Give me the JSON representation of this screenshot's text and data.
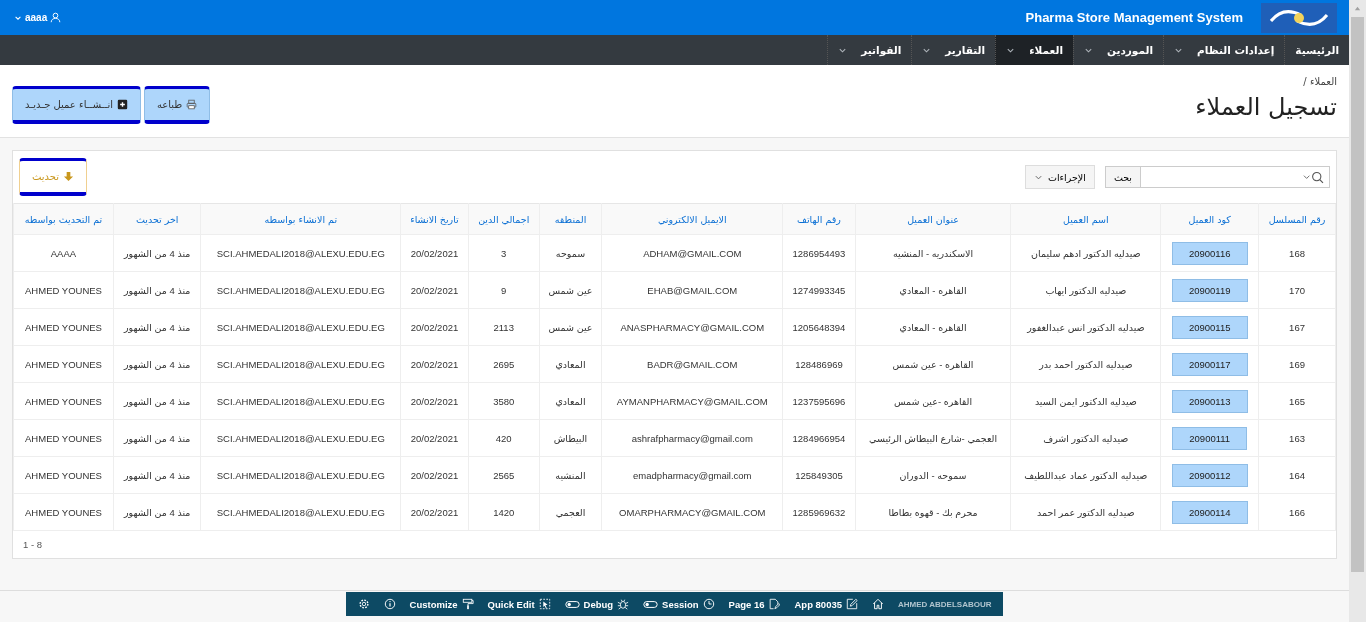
{
  "header": {
    "title": "Pharma Store Management System",
    "user": "aaaa"
  },
  "nav": [
    {
      "label": "الرئيسية",
      "selected": false,
      "dropdown": false
    },
    {
      "label": "إعدادات النظام",
      "selected": false,
      "dropdown": true
    },
    {
      "label": "الموردين",
      "selected": false,
      "dropdown": true
    },
    {
      "label": "العملاء",
      "selected": true,
      "dropdown": true
    },
    {
      "label": "التقارير",
      "selected": false,
      "dropdown": true
    },
    {
      "label": "الفواتير",
      "selected": false,
      "dropdown": true
    }
  ],
  "breadcrumb": "العملاء /",
  "page_title": "تسجيل العملاء",
  "buttons": [
    {
      "label": "طباعه",
      "kind": "print"
    },
    {
      "label": "انــشــاء عميل جـديـد",
      "kind": "create"
    }
  ],
  "toolbar": {
    "search_button": "بحث",
    "actions": "الإجراءات",
    "refresh": "تحديث"
  },
  "table": {
    "columns": [
      "رقم المسلسل",
      "كود العميل",
      "اسم العميل",
      "عنوان العميل",
      "رقم الهاتف",
      "الايميل الالكتروني",
      "المنطقه",
      "اجمالي الدين",
      "تاريخ الانشاء",
      "تم الانشاء بواسطه",
      "اخر تحديث",
      "تم التحديث بواسطه"
    ],
    "rows": [
      [
        "168",
        "20900116",
        "صيدليه الدكتور ادهم سليمان",
        "الاسكندريه - المنشيه",
        "1286954493",
        "ADHAM@GMAIL.COM",
        "سموحه",
        "3",
        "20/02/2021",
        "SCI.AHMEDALI2018@ALEXU.EDU.EG",
        "منذ 4 من الشهور",
        "AAAA"
      ],
      [
        "170",
        "20900119",
        "صيدليه الدكتور ايهاب",
        "القاهره - المعادي",
        "1274993345",
        "EHAB@GMAIL.COM",
        "عين شمس",
        "9",
        "20/02/2021",
        "SCI.AHMEDALI2018@ALEXU.EDU.EG",
        "منذ 4 من الشهور",
        "AHMED YOUNES"
      ],
      [
        "167",
        "20900115",
        "صيدليه الدكتور انس عبدالغفور",
        "القاهره - المعادي",
        "1205648394",
        "ANASPHARMACY@GMAIL.COM",
        "عين شمس",
        "2113",
        "20/02/2021",
        "SCI.AHMEDALI2018@ALEXU.EDU.EG",
        "منذ 4 من الشهور",
        "AHMED YOUNES"
      ],
      [
        "169",
        "20900117",
        "صيدليه الدكتور احمد بدر",
        "القاهره - عين شمس",
        "128486969",
        "BADR@GMAIL.COM",
        "المعادي",
        "2695",
        "20/02/2021",
        "SCI.AHMEDALI2018@ALEXU.EDU.EG",
        "منذ 4 من الشهور",
        "AHMED YOUNES"
      ],
      [
        "165",
        "20900113",
        "صيدليه الدكتور ايمن السيد",
        "القاهره -عين شمس",
        "1237595696",
        "AYMANPHARMACY@GMAIL.COM",
        "المعادي",
        "3580",
        "20/02/2021",
        "SCI.AHMEDALI2018@ALEXU.EDU.EG",
        "منذ 4 من الشهور",
        "AHMED YOUNES"
      ],
      [
        "163",
        "20900111",
        "صيدليه الدكتور اشرف",
        "العجمي -شارع البيطاش الرئيسي",
        "1284966954",
        "ashrafpharmacy@gmail.com",
        "البيطاش",
        "420",
        "20/02/2021",
        "SCI.AHMEDALI2018@ALEXU.EDU.EG",
        "منذ 4 من الشهور",
        "AHMED YOUNES"
      ],
      [
        "164",
        "20900112",
        "صيدليه الدكتور عماد عبداللطيف",
        "سموحه - الدوران",
        "125849305",
        "emadpharmacy@gmail.com",
        "المنشيه",
        "2565",
        "20/02/2021",
        "SCI.AHMEDALI2018@ALEXU.EDU.EG",
        "منذ 4 من الشهور",
        "AHMED YOUNES"
      ],
      [
        "166",
        "20900114",
        "صيدليه الدكتور عمر احمد",
        "محرم بك - قهوه بطاطا",
        "1285969632",
        "OMARPHARMACY@GMAIL.COM",
        "العجمي",
        "1420",
        "20/02/2021",
        "SCI.AHMEDALI2018@ALEXU.EDU.EG",
        "منذ 4 من الشهور",
        "AHMED YOUNES"
      ]
    ],
    "pagination": "1 - 8"
  },
  "dev_toolbar": [
    {
      "kind": "user",
      "label": "AHMED ABDELSABOUR"
    },
    {
      "kind": "home"
    },
    {
      "kind": "app",
      "label": "App 80035"
    },
    {
      "kind": "page",
      "label": "Page 16"
    },
    {
      "kind": "session",
      "label": "Session"
    },
    {
      "kind": "debug",
      "label": "Debug"
    },
    {
      "kind": "quick_edit",
      "label": "Quick Edit"
    },
    {
      "kind": "customize",
      "label": "Customize"
    },
    {
      "kind": "info"
    },
    {
      "kind": "settings"
    }
  ]
}
